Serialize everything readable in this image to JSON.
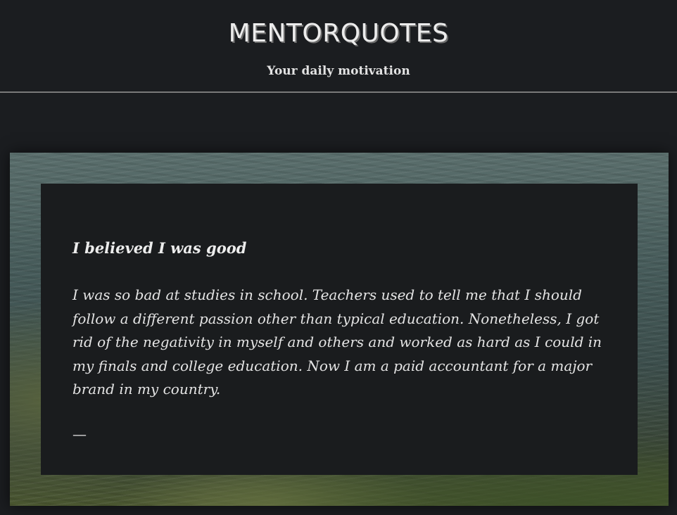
{
  "site": {
    "title": "MENTORQUOTES",
    "tagline": "Your daily motivation"
  },
  "quote": {
    "title": "I believed I was good",
    "body": "I was so bad at studies in school. Teachers used to tell me that I should follow a different passion other than typical education. Nonetheless, I got rid of the negativity in myself and others and worked as hard as I could in my finals and college education. Now I am a paid accountant for a major brand in my country.",
    "attribution": "—"
  }
}
